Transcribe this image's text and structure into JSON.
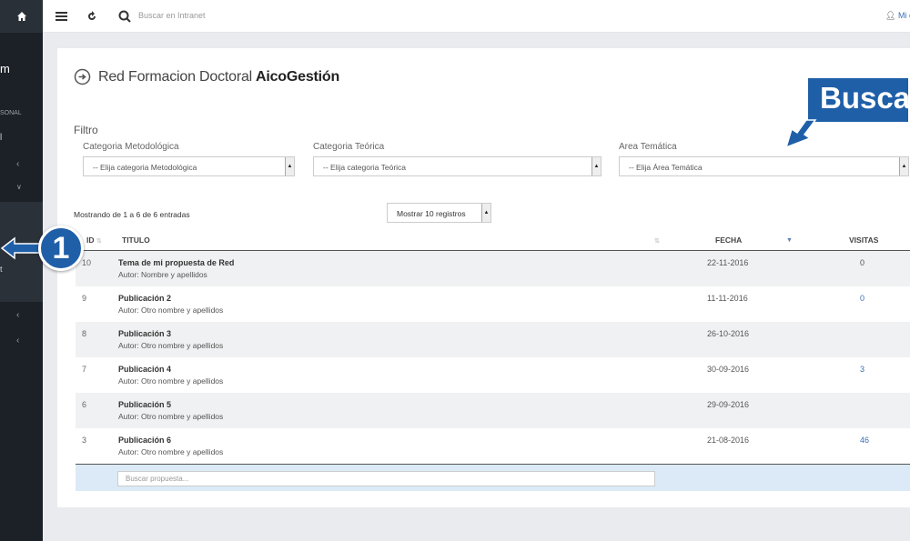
{
  "sidebar": {
    "partial_labels": [
      "m",
      "SONAL",
      "l",
      "t"
    ],
    "accent": "#1c2128"
  },
  "topbar": {
    "search_placeholder": "Buscar en Intranet",
    "user_label": "Mi c"
  },
  "page": {
    "title_light": "Red Formacion Doctoral",
    "title_bold": "AicoGestión"
  },
  "filter": {
    "label": "Filtro",
    "fields": [
      {
        "label": "Categoria Metodológica",
        "value": "-- Elija categoria Metodológica"
      },
      {
        "label": "Categoria Teórica",
        "value": "-- Elija categoria Teórica"
      },
      {
        "label": "Area Temática",
        "value": "-- Elija Área Temática"
      }
    ]
  },
  "table_info": {
    "showing": "Mostrando de 1 a 6 de 6 entradas",
    "page_size": "Mostrar 10 registros"
  },
  "table": {
    "headers": {
      "id": "ID",
      "title": "TITULO",
      "date": "FECHA",
      "visits": "VISITAS"
    },
    "rows": [
      {
        "id": "10",
        "title": "Tema de mi propuesta de Red",
        "author": "Autor: Nombre y apellidos",
        "date": "22-11-2016",
        "visits": "0"
      },
      {
        "id": "9",
        "title": "Publicación 2",
        "author": "Autor: Otro nombre y apellidos",
        "date": "11-11-2016",
        "visits": "0"
      },
      {
        "id": "8",
        "title": "Publicación 3",
        "author": "Autor: Otro nombre y apellidos",
        "date": "26-10-2016",
        "visits": ""
      },
      {
        "id": "7",
        "title": "Publicación 4",
        "author": "Autor: Otro nombre y apellidos",
        "date": "30-09-2016",
        "visits": "3"
      },
      {
        "id": "6",
        "title": "Publicación 5",
        "author": "Autor: Otro nombre y apellidos",
        "date": "29-09-2016",
        "visits": ""
      },
      {
        "id": "3",
        "title": "Publicación 6",
        "author": "Autor: Otro nombre y apellidos",
        "date": "21-08-2016",
        "visits": "46"
      }
    ],
    "search_placeholder": "Buscar propuesta..."
  },
  "callouts": {
    "busca_text": "Busca",
    "step_number": "1",
    "color": "#1f5fa8"
  }
}
